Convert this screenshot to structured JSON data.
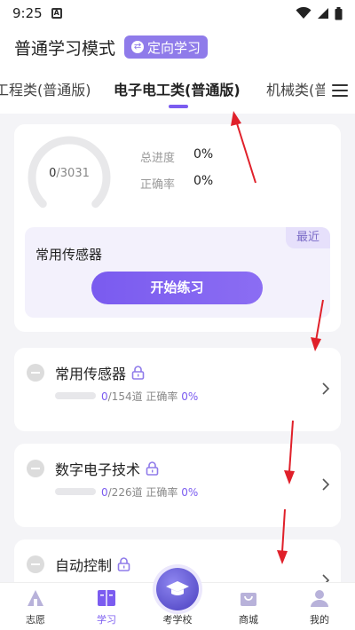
{
  "status_bar": {
    "time": "9:25",
    "notif_glyph": "A"
  },
  "header": {
    "title": "普通学习模式",
    "mode_button": "定向学习"
  },
  "tabs": [
    {
      "label": "工程类(普通版)"
    },
    {
      "label": "电子电工类(普通版)",
      "active": true
    },
    {
      "label": "机械类(普"
    }
  ],
  "summary": {
    "done": "0",
    "total": "/3031",
    "progress_fraction": 0,
    "stats": [
      {
        "label": "总进度",
        "value": "0%"
      },
      {
        "label": "正确率",
        "value": "0%"
      }
    ]
  },
  "recent": {
    "tag": "最近",
    "name": "常用传感器",
    "button": "开始练习"
  },
  "chapters": [
    {
      "title": "常用传感器",
      "done": "0",
      "total_text": "/154道 正确率 ",
      "accuracy": "0%"
    },
    {
      "title": "数字电子技术",
      "done": "0",
      "total_text": "/226道 正确率 ",
      "accuracy": "0%"
    },
    {
      "title": "自动控制",
      "done": "",
      "total_text": "",
      "accuracy": ""
    }
  ],
  "bottom_nav": [
    {
      "label": "志愿",
      "icon": "volunteer-icon"
    },
    {
      "label": "学习",
      "icon": "book-icon",
      "active": true
    },
    {
      "label": "考学校",
      "icon": "graduation-cap-icon"
    },
    {
      "label": "商城",
      "icon": "shop-icon"
    },
    {
      "label": "我的",
      "icon": "profile-icon"
    }
  ],
  "colors": {
    "accent": "#7b5cf0",
    "mode_button": "#8f7bea",
    "annotation_arrow": "#e0202a"
  }
}
